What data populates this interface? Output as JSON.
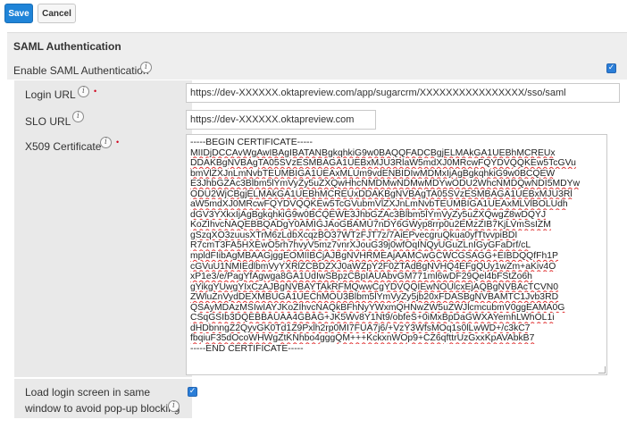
{
  "toolbar": {
    "save_label": "Save",
    "cancel_label": "Cancel"
  },
  "section": {
    "title": "SAML Authentication"
  },
  "enable_saml": {
    "label": "Enable SAML Authentication",
    "checked": true
  },
  "fields": {
    "login_url": {
      "label": "Login URL",
      "required": true,
      "value": "https://dev-XXXXXX.oktapreview.com/app/sugarcrm/XXXXXXXXXXXXXXXX/sso/saml"
    },
    "slo_url": {
      "label": "SLO URL",
      "required": false,
      "value": "https://dev-XXXXXX.oktapreview.com"
    },
    "x509": {
      "label": "X509 Certificate",
      "required": true,
      "lines": [
        "-----BEGIN CERTIFICATE-----",
        "MIIDjDCCAvWgAwIBAgIBATANBgkqhkiG9w0BAQQFADCBgjELMAkGA1UEBhMCREUx",
        "DDAKBgNVBAgTA05SVzESMBAGA1UEBxMJU3RlaW5mdXJ0MRcwFQYDVQQKEw5TcGVu",
        "bmVlZXJnLmNvbTEUMBIGA1UEAxMLUm9vdENBIDIwMDMxIjAgBgkqhkiG9w0BCQEW",
        "E3JhbGZAc3Blbm5lYmVyZy5uZXQwHhcNMDMwNDMwMDYwODU2WhcNMDQwNDI5MDYw",
        "ODU2WjCBgjELMAkGA1UEBhMCREUxDDAKBgNVBAgTA05SVzESMBAGA1UEBxMJU3Rl",
        "aW5mdXJ0MRcwFQYDVQQKEw5TcGVubmVlZXJnLmNvbTEUMBIGA1UEAxMLVlBOLUdh",
        "dGV3YXkxIjAgBgkqhkiG9w0BCQEWE3JhbGZAc3Blbm5lYmVyZy5uZXQwgZ8wDQYJ",
        "KoZIhvcNAQEBBQADgY0AMIGJAoGBAMU7nDY6GWyp8rrp0u2EMzZIB7KjLVmSsIZM",
        "gSzqXO3zuusXTrM6zLdbXcqzBO37WTzFJT7z/7AiEPvecgruQkua0yfTtvvpiBDI",
        "R7cmT3FA5HXEwO5rh7hvyV5mz7vnrXJouG39j0wfOqINQyUGuZLnIGyGFaDrf/cL",
        "mpldFIibAgMBAAGjggEOMIIBCjAJBgNVHRMEAjAAMCwGCWCGSAGG+EIBDQQfFh1P",
        "cGVuU1NMIEdlbmVyYXRlZCBDZXJ0aWZpY2F0ZTAdBgNVHQ4EFgQUy1wZm+aKiv4O",
        "xP1e3/e/PagYfAgwga8GA1UdIwSBpzCBpIAUAbvGM771ml6wDF29Qel4bFStZo6h",
        "gYikgYUwgYIxCzAJBgNVBAYTAkRFMQwwCgYDVQQIEwNOUlcxEjAQBgNVBAcTCVN0",
        "ZWluZnVydDEXMBUGA1UEChMOU3Blbm5lYmVyZy5jb20xFDASBgNVBAMTC1Jvb3RD",
        "QSAyMDAzMSIwIAYJKoZIhvcNAQkBFhNyYWxmQHNwZW5uZWJlcmcubmV0ggEAMA0G",
        "CSqGSIb3DQEBBAUAA4GBAG+JK5Wv8Y1Nt9/obfeS+0iMxBpDaGWXAYemhLWhOL1i",
        "dHDbnngZ2QyvGK0Td1Z9Pxlh2rp0MI7FUA7j6/+VzY3WfsMOq1s0lLwWD+/c3kC7",
        "fbqiuF35dOcoWHWgZtKNhbo4gggQM+++KckxnWOp9+CZ6qfttrUzGxxKpAVAbkB7",
        "-----END CERTIFICATE-----"
      ]
    },
    "load_login": {
      "label_line1": "Load login screen in same",
      "label_line2": "window to avoid pop-up blocking",
      "checked": true
    }
  },
  "icons": {
    "info": "info-icon",
    "checkmark": "checkmark-icon"
  },
  "colors": {
    "save_button": "#1f84d8",
    "checkbox": "#2b7ed8",
    "required": "#d0021b"
  }
}
